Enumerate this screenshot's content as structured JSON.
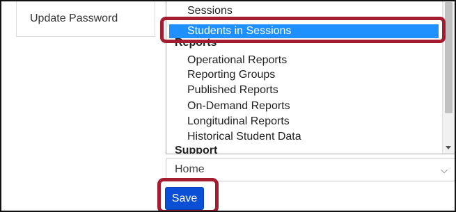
{
  "sidebar": {
    "item": "Update Password"
  },
  "list": {
    "sessions": "Sessions",
    "students_in_sessions": "Students in Sessions",
    "reports_group": "Reports",
    "reports_items": [
      "Operational Reports",
      "Reporting Groups",
      "Published Reports",
      "On-Demand Reports",
      "Longitudinal Reports",
      "Historical Student Data"
    ],
    "support_group": "Support"
  },
  "home_select": {
    "value": "Home"
  },
  "save": {
    "label": "Save"
  },
  "colors": {
    "selection": "#1e90ff",
    "highlight": "#a51c30",
    "button": "#0b4fd6"
  },
  "icons": [
    "chevron-down-icon",
    "scroll-down-arrow-icon"
  ]
}
